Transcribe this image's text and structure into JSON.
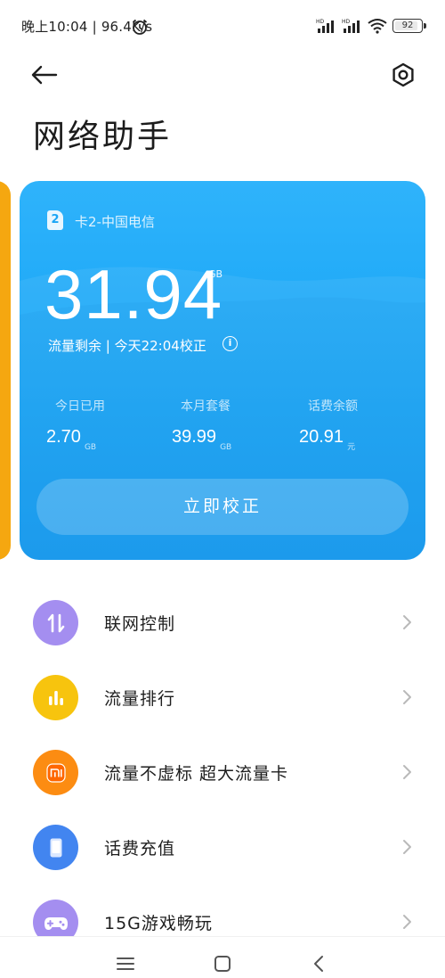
{
  "status_bar": {
    "text": "晚上10:04 | 96.4K/s",
    "battery": "92",
    "battery_level": 0.92
  },
  "header": {
    "title": "网络助手"
  },
  "data_card": {
    "sim_slot": "2",
    "carrier": "卡2-中国电信",
    "remaining_value": "31.94",
    "remaining_unit": "GB",
    "remaining_label": "流量剩余 | 今天22:04校正",
    "stats": [
      {
        "label": "今日已用",
        "value": "2.70",
        "unit": "GB"
      },
      {
        "label": "本月套餐",
        "value": "39.99",
        "unit": "GB"
      },
      {
        "label": "话费余额",
        "value": "20.91",
        "unit": "元"
      }
    ],
    "calibrate_label": "立即校正",
    "color": "#1aa5f5"
  },
  "menu": {
    "items": [
      {
        "label": "联网控制",
        "icon": "arrows-updown-icon",
        "color": "#a48ef0"
      },
      {
        "label": "流量排行",
        "icon": "bar-chart-icon",
        "color": "#f7c40e"
      },
      {
        "label": "流量不虚标 超大流量卡",
        "icon": "mi-logo-icon",
        "color": "#fc8c12"
      },
      {
        "label": "话费充值",
        "icon": "phone-icon",
        "color": "#4285f0"
      },
      {
        "label": "15G游戏畅玩",
        "icon": "gamepad-icon",
        "color": "#a48ef0"
      }
    ]
  },
  "colors": {
    "accent_card": "#1aa5f5",
    "peek_card": "#f5a710"
  }
}
